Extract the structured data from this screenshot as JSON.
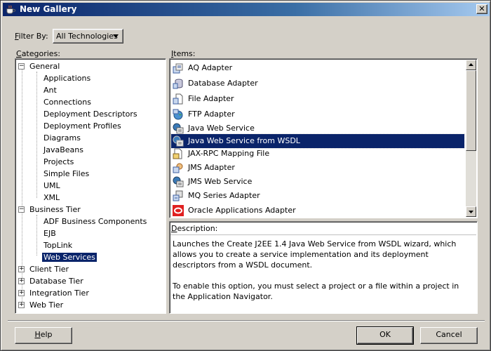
{
  "window": {
    "title": "New Gallery",
    "close_glyph": "✕"
  },
  "filter": {
    "label_prefix": "F",
    "label_rest": "ilter By:",
    "value": "All Technologies"
  },
  "categories": {
    "label_prefix": "C",
    "label_rest": "ategories:",
    "general": {
      "label": "General",
      "children": [
        "Applications",
        "Ant",
        "Connections",
        "Deployment Descriptors",
        "Deployment Profiles",
        "Diagrams",
        "JavaBeans",
        "Projects",
        "Simple Files",
        "UML",
        "XML"
      ]
    },
    "business_tier": {
      "label": "Business Tier",
      "children": [
        "ADF Business Components",
        "EJB",
        "TopLink",
        "Web Services"
      ]
    },
    "collapsed": [
      "Client Tier",
      "Database Tier",
      "Integration Tier",
      "Web Tier"
    ]
  },
  "items": {
    "label_prefix": "I",
    "label_rest": "tems:",
    "list": [
      "AQ Adapter",
      "Database Adapter",
      "File Adapter",
      "FTP Adapter",
      "Java Web Service",
      "Java Web Service from WSDL",
      "JAX-RPC Mapping File",
      "JMS Adapter",
      "JMS Web Service",
      "MQ Series Adapter",
      "Oracle Applications Adapter"
    ],
    "selected": "Java Web Service from WSDL"
  },
  "description": {
    "label_prefix": "D",
    "label_rest": "escription:",
    "para1": "Launches the Create J2EE 1.4 Java Web Service from WSDL wizard, which allows you to create a service implementation and its deployment descriptors from a WSDL document.",
    "para2": "To enable this option, you must select a project or a file within a project in the Application Navigator."
  },
  "buttons": {
    "help_prefix": "H",
    "help_rest": "elp",
    "ok": "OK",
    "cancel": "Cancel"
  },
  "colors": {
    "selection": "#0a246a",
    "titlebar": "#0a246a",
    "face": "#d4d0c8"
  }
}
